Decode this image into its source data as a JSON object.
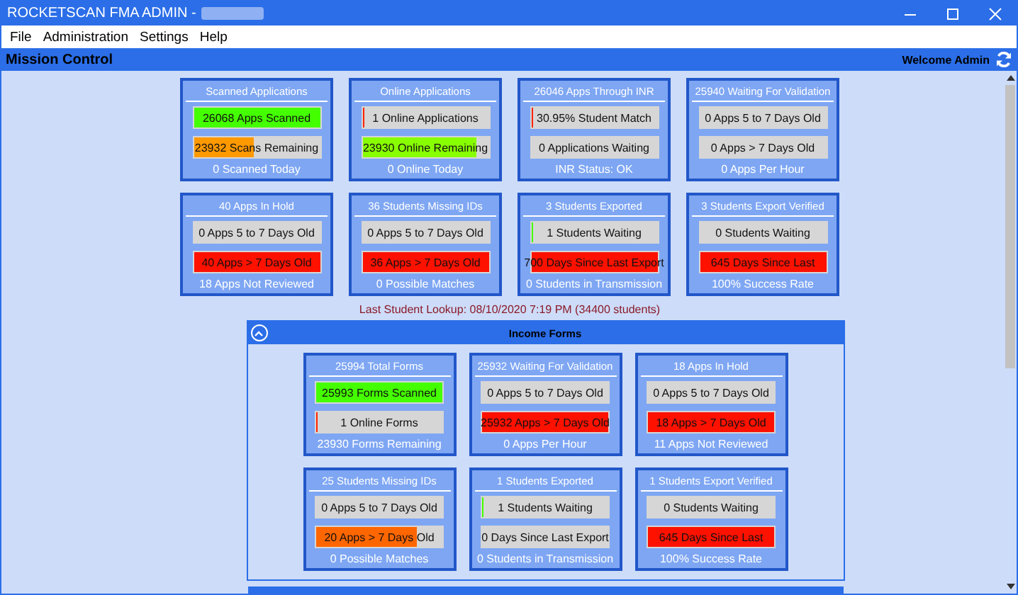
{
  "window": {
    "title": "ROCKETSCAN FMA ADMIN -"
  },
  "menu": [
    "File",
    "Administration",
    "Settings",
    "Help"
  ],
  "header": {
    "title": "Mission Control",
    "welcome": "Welcome Admin"
  },
  "cards": [
    {
      "title": "Scanned Applications",
      "bars": [
        {
          "label": "26068 Apps Scanned",
          "level": 1,
          "color": "#44ff00"
        },
        {
          "label": "23932 Scans Remaining",
          "level": 0.48,
          "color": "#ff9900"
        }
      ],
      "footer": "0 Scanned Today"
    },
    {
      "title": "Online Applications",
      "bars": [
        {
          "label": "1 Online Applications",
          "level": 0.01,
          "color": "#ff2200"
        },
        {
          "label": "23930 Online Remaining",
          "level": 0.91,
          "color": "#88ff00"
        }
      ],
      "footer": "0 Online Today"
    },
    {
      "title": "26046 Apps Through INR",
      "bars": [
        {
          "label": "30.95% Student Match",
          "level": 0.01,
          "color": "#ff2200"
        },
        {
          "label": "0 Applications Waiting"
        }
      ],
      "footer": "INR Status: OK"
    },
    {
      "title": "25940 Waiting For Validation",
      "bars": [
        {
          "label": "0 Apps 5 to 7 Days Old"
        },
        {
          "label": "0 Apps > 7 Days Old"
        }
      ],
      "footer": "0 Apps Per Hour"
    },
    {
      "title": "40 Apps In Hold",
      "bars": [
        {
          "label": "0 Apps 5 to 7 Days Old"
        },
        {
          "label": "40 Apps > 7 Days Old",
          "level": 1,
          "color": "#ff1100"
        }
      ],
      "footer": "18 Apps Not Reviewed"
    },
    {
      "title": "36 Students Missing IDs",
      "bars": [
        {
          "label": "0 Apps 5 to 7 Days Old"
        },
        {
          "label": "36 Apps > 7 Days Old",
          "level": 1,
          "color": "#ff1100"
        }
      ],
      "footer": "0 Possible Matches"
    },
    {
      "title": "3 Students Exported",
      "bars": [
        {
          "label": "1 Students Waiting",
          "level": 0.01,
          "color": "#44ff00"
        },
        {
          "label": "700 Days Since Last Export",
          "level": 1,
          "color": "#ff1100"
        }
      ],
      "footer": "0 Students in Transmission"
    },
    {
      "title": "3 Students Export Verified",
      "bars": [
        {
          "label": "0 Students Waiting"
        },
        {
          "label": "645 Days Since Last",
          "level": 1,
          "color": "#ff1100"
        }
      ],
      "footer": "100% Success Rate"
    }
  ],
  "last_lookup": "Last Student Lookup: 08/10/2020 7:19 PM (34400 students)",
  "income_panel": {
    "title": "Income Forms",
    "expanded": true,
    "cards": [
      {
        "title": "25994 Total Forms",
        "bars": [
          {
            "label": "25993 Forms Scanned",
            "level": 1,
            "color": "#44ff00"
          },
          {
            "label": "1 Online Forms",
            "level": 0.01,
            "color": "#ff2200"
          }
        ],
        "footer": "23930 Forms Remaining"
      },
      {
        "title": "25932 Waiting For Validation",
        "bars": [
          {
            "label": "0 Apps 5 to 7 Days Old"
          },
          {
            "label": "25932 Apps > 7 Days Old",
            "level": 1,
            "color": "#ff1100"
          }
        ],
        "footer": "0 Apps Per Hour"
      },
      {
        "title": "18 Apps In Hold",
        "bars": [
          {
            "label": "0 Apps 5 to 7 Days Old"
          },
          {
            "label": "18 Apps > 7 Days Old",
            "level": 1,
            "color": "#ff1100"
          }
        ],
        "footer": "11 Apps Not Reviewed"
      },
      {
        "title": "25 Students Missing IDs",
        "bars": [
          {
            "label": "0 Apps 5 to 7 Days Old"
          },
          {
            "label": "20 Apps > 7 Days Old",
            "level": 0.8,
            "color": "#ff6600"
          }
        ],
        "footer": "0 Possible Matches"
      },
      {
        "title": "1 Students Exported",
        "bars": [
          {
            "label": "1 Students Waiting",
            "level": 0.01,
            "color": "#44ff00"
          },
          {
            "label": "0 Days Since Last Export"
          }
        ],
        "footer": "0 Students in Transmission"
      },
      {
        "title": "1 Students Export Verified",
        "bars": [
          {
            "label": "0 Students Waiting"
          },
          {
            "label": "645 Days Since Last",
            "level": 1,
            "color": "#ff1100"
          }
        ],
        "footer": "100% Success Rate"
      }
    ]
  }
}
